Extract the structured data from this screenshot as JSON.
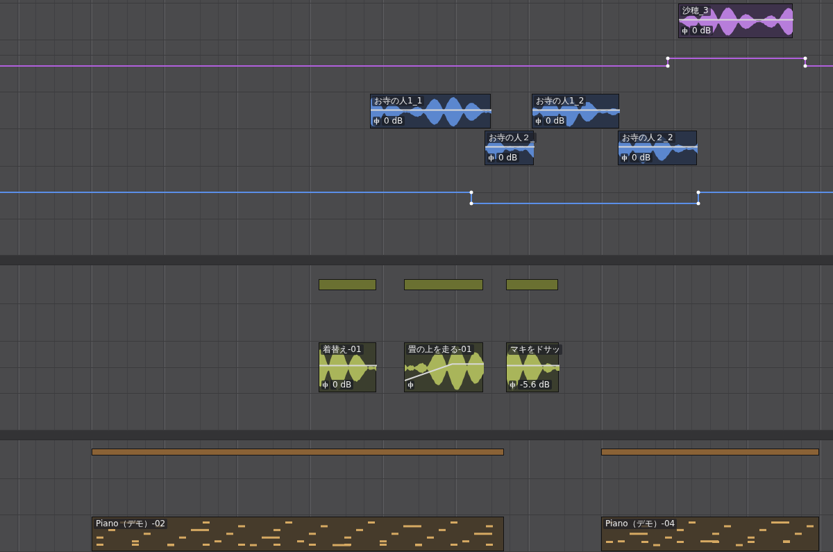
{
  "regions": [
    {
      "kind": "audio",
      "name": "沙穂_3",
      "gain": "0 dB",
      "color": "#b77ddb"
    },
    {
      "kind": "audio",
      "name": "お寺の人1_1",
      "gain": "0 dB",
      "color": "#5b87cf"
    },
    {
      "kind": "audio",
      "name": "お寺の人1_2",
      "gain": "0 dB",
      "color": "#5b87cf"
    },
    {
      "kind": "audio",
      "name": "お寺の人２_",
      "gain": "0 dB",
      "color": "#5b87cf"
    },
    {
      "kind": "audio",
      "name": "お寺の人２_2",
      "gain": "0 dB",
      "color": "#5b87cf"
    },
    {
      "kind": "block",
      "color": "#6a7031"
    },
    {
      "kind": "block",
      "color": "#6a7031"
    },
    {
      "kind": "block",
      "color": "#6a7031"
    },
    {
      "kind": "audio",
      "name": "着替え-01",
      "gain": "0 dB",
      "color": "#a9b55a"
    },
    {
      "kind": "audio",
      "name": "畳の上を走る-01",
      "color": "#a9b55a"
    },
    {
      "kind": "audio",
      "name": "マキをドサッ",
      "gain": "-5.6 dB",
      "color": "#a9b55a"
    },
    {
      "kind": "block",
      "color": "#8a6236"
    },
    {
      "kind": "block",
      "color": "#8a6236"
    },
    {
      "kind": "midi",
      "name": "Piano（デモ）-02",
      "color": "#d6a962"
    },
    {
      "kind": "midi",
      "name": "Piano（デモ）-04",
      "color": "#d6a962"
    }
  ]
}
